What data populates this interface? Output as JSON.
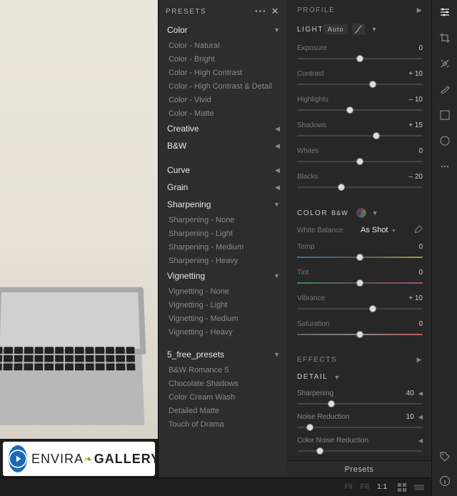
{
  "presets": {
    "header": "PRESETS",
    "groups": [
      {
        "name": "Color",
        "expanded": true,
        "items": [
          "Color - Natural",
          "Color - Bright",
          "Color - High Contrast",
          "Color - High Contrast & Detail",
          "Color - Vivid",
          "Color - Matte"
        ]
      },
      {
        "name": "Creative",
        "expanded": false,
        "items": []
      },
      {
        "name": "B&W",
        "expanded": false,
        "items": []
      },
      {
        "gap": true
      },
      {
        "name": "Curve",
        "expanded": false,
        "items": []
      },
      {
        "name": "Grain",
        "expanded": false,
        "items": []
      },
      {
        "name": "Sharpening",
        "expanded": true,
        "items": [
          "Sharpening - None",
          "Sharpening - Light",
          "Sharpening - Medium",
          "Sharpening - Heavy"
        ]
      },
      {
        "name": "Vignetting",
        "expanded": true,
        "items": [
          "Vignetting - None",
          "Vignetting - Light",
          "Vignetting - Medium",
          "Vignetting - Heavy"
        ]
      },
      {
        "gap": true
      },
      {
        "name": "5_free_presets",
        "expanded": true,
        "items": [
          "B&W Romance 5",
          "Chocolate Shadows",
          "Color Cream Wash",
          "Detailed Matte",
          "Touch of Drama"
        ]
      }
    ]
  },
  "edit": {
    "profile_label": "PROFILE",
    "light": {
      "label": "LIGHT",
      "auto": "Auto",
      "sliders": [
        {
          "label": "Exposure",
          "value": "0",
          "pos": 50
        },
        {
          "label": "Contrast",
          "value": "+ 10",
          "pos": 60
        },
        {
          "label": "Highlights",
          "value": "– 10",
          "pos": 42
        },
        {
          "label": "Shadows",
          "value": "+ 15",
          "pos": 63
        },
        {
          "label": "Whites",
          "value": "0",
          "pos": 50
        },
        {
          "label": "Blacks",
          "value": "– 20",
          "pos": 35
        }
      ]
    },
    "color": {
      "label": "COLOR",
      "bw": "B&W",
      "wb_label": "White Balance",
      "wb_value": "As Shot",
      "sliders": [
        {
          "label": "Temp",
          "value": "0",
          "pos": 50,
          "grad": "temp"
        },
        {
          "label": "Tint",
          "value": "0",
          "pos": 50,
          "grad": "tint"
        },
        {
          "label": "Vibrance",
          "value": "+ 10",
          "pos": 60
        },
        {
          "label": "Saturation",
          "value": "0",
          "pos": 50,
          "grad": "sat"
        }
      ]
    },
    "effects_label": "EFFECTS",
    "detail": {
      "label": "DETAIL",
      "rows": [
        {
          "label": "Sharpening",
          "value": "40",
          "pos": 27
        },
        {
          "label": "Noise Reduction",
          "value": "10",
          "pos": 10
        },
        {
          "label": "Color Noise Reduction",
          "value": "",
          "pos": 18
        }
      ]
    }
  },
  "tools": [
    "edit-sliders",
    "crop",
    "healing",
    "brush",
    "linear-gradient",
    "radial-gradient",
    "more"
  ],
  "bottombar": {
    "zoom": [
      "Fit",
      "Fill",
      "1:1"
    ],
    "active_zoom": "1:1",
    "presets_tab": "Presets"
  },
  "logo": {
    "text1": "ENVIRA",
    "text2": "GALLERY"
  }
}
